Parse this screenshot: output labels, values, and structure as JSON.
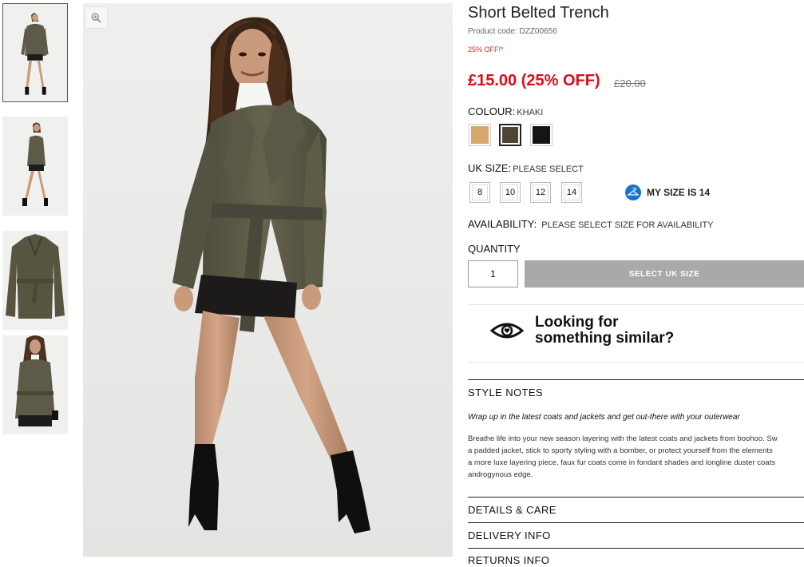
{
  "product": {
    "title": "Short Belted Trench",
    "code": "Product code: DZZ00656",
    "promo": "25% OFF!*",
    "price": "£15.00 (25% OFF)",
    "old_price": "£20.00"
  },
  "colour": {
    "label": "COLOUR:",
    "value": "KHAKI",
    "swatches": [
      {
        "name": "camel",
        "hex": "#d8a56b"
      },
      {
        "name": "khaki",
        "hex": "#4f4535"
      },
      {
        "name": "black",
        "hex": "#151515"
      }
    ]
  },
  "size": {
    "label": "UK SIZE:",
    "value": "PLEASE SELECT",
    "options": [
      "8",
      "10",
      "12",
      "14"
    ],
    "my_size": "MY SIZE IS 14"
  },
  "availability": {
    "label": "AVAILABILITY:",
    "value": "PLEASE SELECT SIZE FOR AVAILABILITY"
  },
  "quantity": {
    "label": "QUANTITY",
    "value": "1"
  },
  "cta": "SELECT UK SIZE",
  "similar": {
    "line1": "Looking for",
    "line2": "something similar?"
  },
  "style_notes": {
    "title": "STYLE NOTES",
    "italic": "Wrap up in the latest coats and jackets and get out-there with your outerwear",
    "body_lines": [
      "Breathe life into your new season layering with the latest coats and jackets from boohoo. Sw",
      "a padded jacket, stick to sporty styling with a bomber, or protect yourself from the elements",
      "a more luxe layering piece, faux fur coats come in fondant shades and longline duster coats",
      "androgynous edge."
    ]
  },
  "sections": [
    "DETAILS & CARE",
    "DELIVERY INFO",
    "RETURNS INFO"
  ],
  "colors": {
    "sale_red": "#e00b16",
    "cta_grey": "#a9a9a9",
    "size_icon_blue": "#1a73c9"
  }
}
